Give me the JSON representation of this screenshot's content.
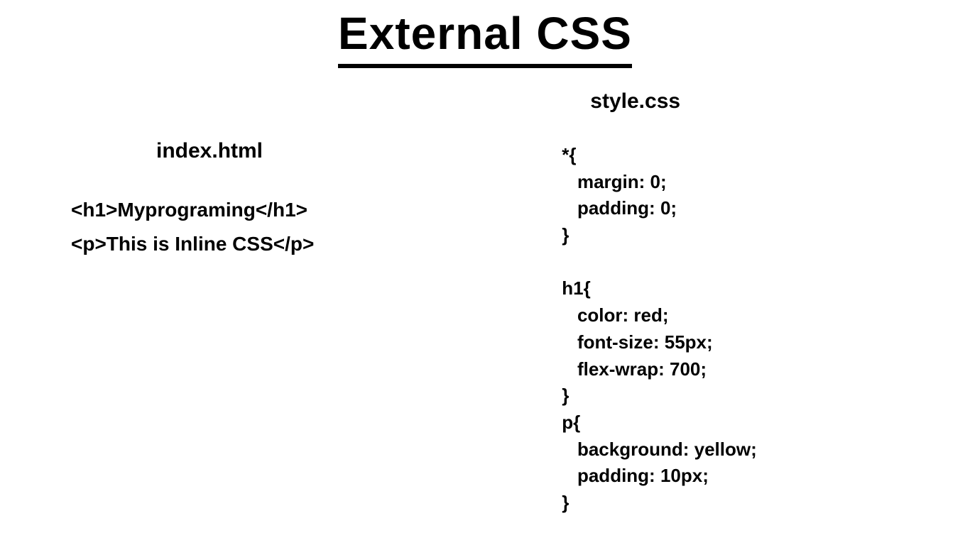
{
  "title": "External CSS",
  "left": {
    "filename": "index.html",
    "line1": "<h1>Myprograming</h1>",
    "line2": "<p>This is Inline CSS</p>"
  },
  "right": {
    "filename": "style.css",
    "css": "*{\n   margin: 0;\n   padding: 0;\n}\n\nh1{\n   color: red;\n   font-size: 55px;\n   flex-wrap: 700;\n}\np{\n   background: yellow;\n   padding: 10px;\n}"
  }
}
